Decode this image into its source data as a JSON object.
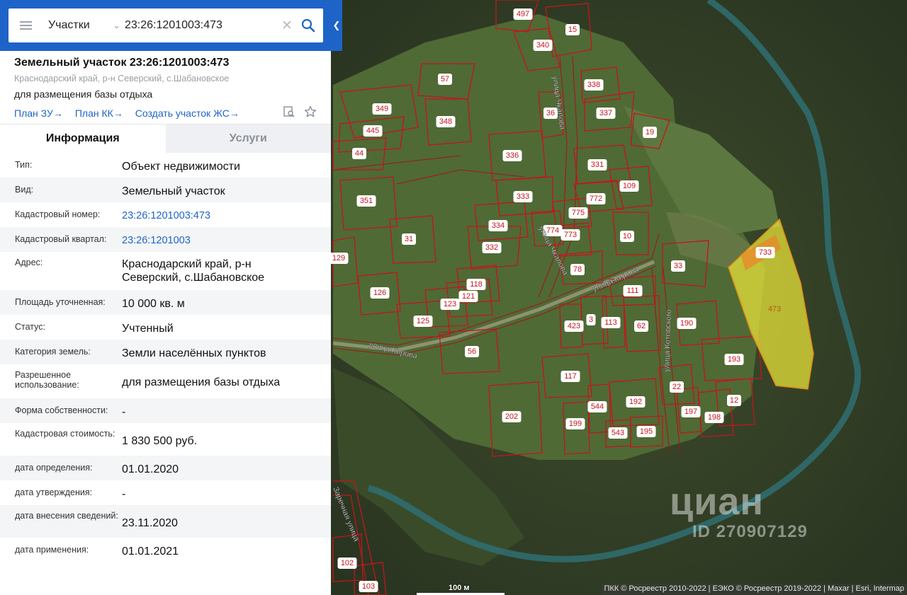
{
  "search": {
    "layer_label": "Участки",
    "query": "23:26:1201003:473"
  },
  "header": {
    "title": "Земельный участок 23:26:1201003:473",
    "address": "Краснодарский край, р-н Северский, с.Шабановское",
    "purpose": "для размещения базы отдыха",
    "links": [
      {
        "label": "План ЗУ",
        "arrow": "→"
      },
      {
        "label": "План КК",
        "arrow": "→"
      },
      {
        "label": "Создать участок ЖС",
        "arrow": "→"
      }
    ]
  },
  "tabs": [
    {
      "label": "Информация",
      "active": true
    },
    {
      "label": "Услуги",
      "active": false
    }
  ],
  "info_rows": [
    {
      "key": "Тип:",
      "value": "Объект недвижимости"
    },
    {
      "key": "Вид:",
      "value": "Земельный участок"
    },
    {
      "key": "Кадастровый номер:",
      "value": "23:26:1201003:473",
      "link": true
    },
    {
      "key": "Кадастровый квартал:",
      "value": "23:26:1201003",
      "link": true
    },
    {
      "key": "Адрес:",
      "value": "Краснодарский край, р-н Северский, с.Шабановское"
    },
    {
      "key": "Площадь уточненная:",
      "value": "10 000 кв. м"
    },
    {
      "key": "Статус:",
      "value": "Учтенный"
    },
    {
      "key": "Категория земель:",
      "value": "Земли населённых пунктов"
    },
    {
      "key": "Разрешенное использование:",
      "value": "для размещения базы отдыха"
    },
    {
      "key": "Форма собственности:",
      "value": "-"
    },
    {
      "key": "Кадастровая стоимость:",
      "value": "1 830 500 руб."
    },
    {
      "key": "дата определения:",
      "value": "01.01.2020"
    },
    {
      "key": "дата утверждения:",
      "value": "-"
    },
    {
      "key": "дата внесения сведений:",
      "value": "23.11.2020"
    },
    {
      "key": "дата применения:",
      "value": "01.01.2021"
    }
  ],
  "map": {
    "scale_label": "100 м",
    "attribution": "ПКК © Росреестр 2010-2022 | ЕЭКО © Росреестр 2019-2022 | Maxar | Esri, Intermap",
    "watermark": "циан",
    "watermark_id": "ID 270907129",
    "selected_parcel": "473",
    "parcel_numbers": [
      "497",
      "15",
      "340",
      "57",
      "338",
      "349",
      "36",
      "337",
      "348",
      "445",
      "19",
      "44",
      "336",
      "331",
      "109",
      "351",
      "333",
      "772",
      "775",
      "774",
      "334",
      "10",
      "31",
      "332",
      "773",
      "129",
      "33",
      "78",
      "118",
      "126",
      "121",
      "111",
      "123",
      "3",
      "423",
      "113",
      "62",
      "190",
      "125",
      "56",
      "193",
      "117",
      "22",
      "12",
      "197",
      "198",
      "192",
      "202",
      "544",
      "199",
      "543",
      "195",
      "102",
      "103",
      "733",
      "473"
    ],
    "streets": [
      "улица Чкалова",
      "улица Чкалова",
      "улица Кирова",
      "улица Кирова",
      "улица Котовского",
      "Заречная улица"
    ],
    "colors": {
      "parcel_border": "#c4161c",
      "selected_fill": "#e7e23a",
      "panel_accent": "#1e64c8"
    }
  }
}
